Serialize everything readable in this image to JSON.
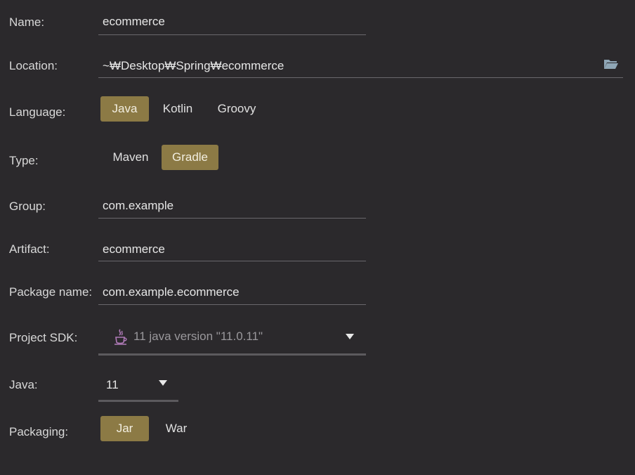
{
  "form": {
    "name": {
      "label": "Name:",
      "value": "ecommerce"
    },
    "location": {
      "label": "Location:",
      "value": "~₩Desktop₩Spring₩ecommerce",
      "icon": "folder-icon"
    },
    "language": {
      "label": "Language:",
      "options": [
        "Java",
        "Kotlin",
        "Groovy"
      ],
      "selected": "Java"
    },
    "type": {
      "label": "Type:",
      "options": [
        "Maven",
        "Gradle"
      ],
      "selected": "Gradle"
    },
    "group": {
      "label": "Group:",
      "value": "com.example"
    },
    "artifact": {
      "label": "Artifact:",
      "value": "ecommerce"
    },
    "package_name": {
      "label": "Package name:",
      "value": "com.example.ecommerce"
    },
    "project_sdk": {
      "label": "Project SDK:",
      "value": "11 java version \"11.0.11\"",
      "icon": "java-cup-icon"
    },
    "java": {
      "label": "Java:",
      "value": "11"
    },
    "packaging": {
      "label": "Packaging:",
      "options": [
        "Jar",
        "War"
      ],
      "selected": "Jar"
    }
  },
  "colors": {
    "background": "#2b292c",
    "selected_segment": "#8c7a45",
    "underline": "#6a686c",
    "muted_text": "#9a989c",
    "folder_icon": "#8fa6b6",
    "java_icon": "#b07ab8"
  }
}
